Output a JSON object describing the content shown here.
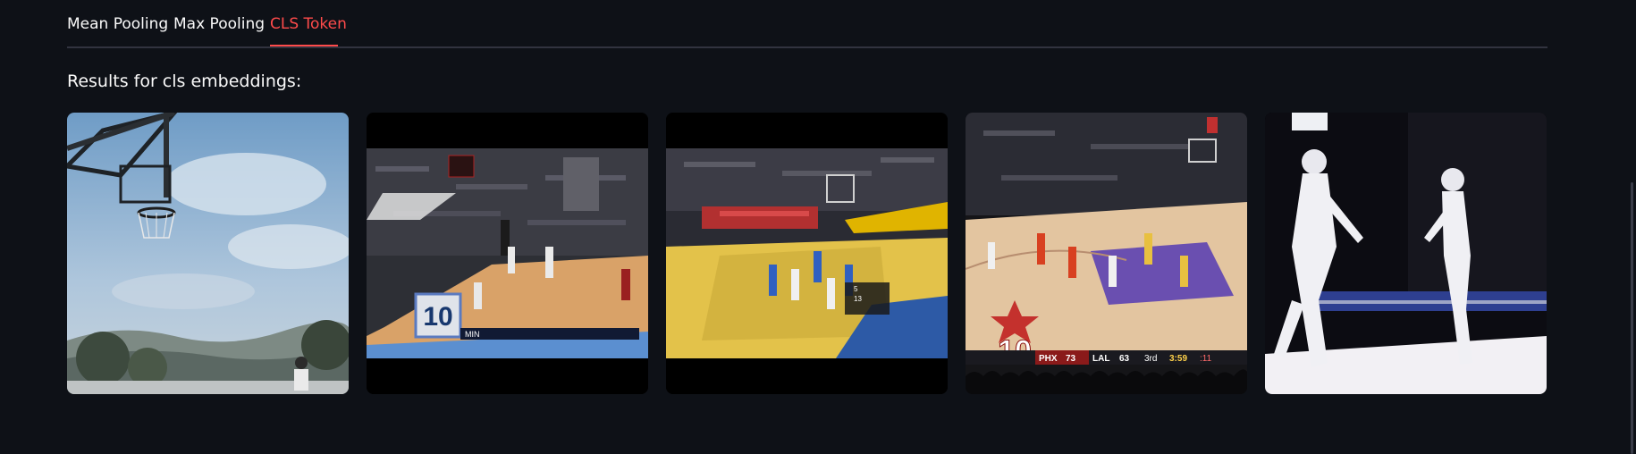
{
  "tabs": [
    {
      "label": "Mean Pooling",
      "active": false
    },
    {
      "label": "Max Pooling",
      "active": false
    },
    {
      "label": "CLS Token",
      "active": true
    }
  ],
  "heading": "Results for cls embeddings:",
  "colors": {
    "background": "#0e1117",
    "text": "#fafafa",
    "accent": "#ff4b4b",
    "divider": "#31333f"
  },
  "results": [
    {
      "scene": "outdoor-basketball-hoop"
    },
    {
      "scene": "basketball-game-broadcast-1",
      "scoreboard": {
        "badge": "10",
        "team_a": "MIN"
      }
    },
    {
      "scene": "basketball-game-broadcast-2",
      "scoreboard": {
        "scores": [
          "5",
          "13"
        ]
      }
    },
    {
      "scene": "basketball-game-broadcast-3",
      "scoreboard": {
        "badge": "10",
        "team_a": "PHX",
        "score_a": "73",
        "team_b": "LAL",
        "score_b": "63",
        "period": "3rd",
        "clock": "3:59",
        "shot_clock": ":11"
      }
    },
    {
      "scene": "fencing-match"
    }
  ]
}
